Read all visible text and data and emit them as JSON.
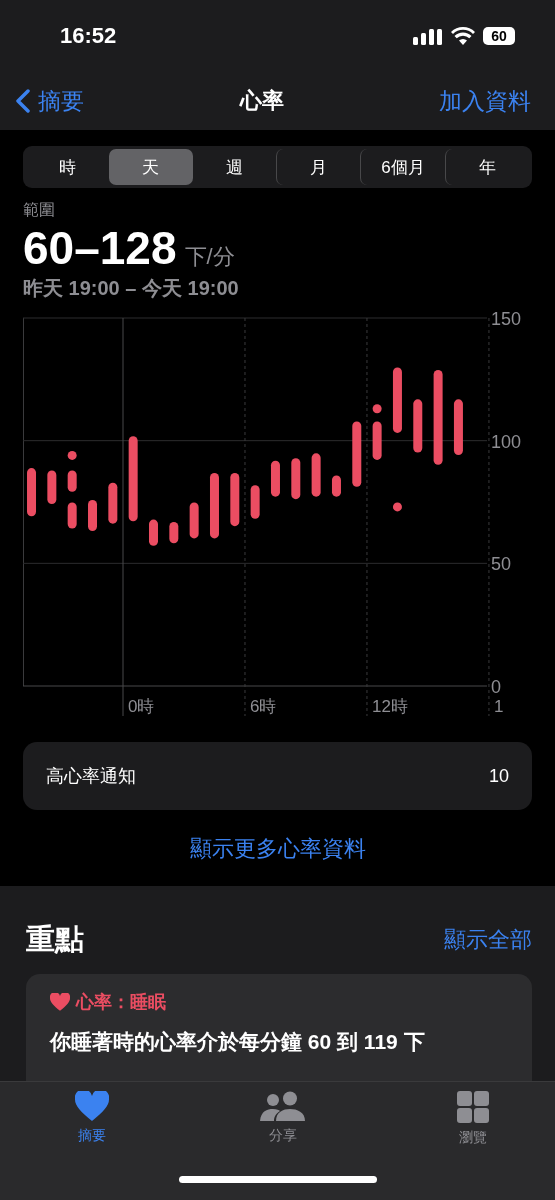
{
  "status_bar": {
    "time": "16:52",
    "battery": "60"
  },
  "nav": {
    "back": "摘要",
    "title": "心率",
    "action": "加入資料"
  },
  "segments": [
    {
      "label": "時",
      "selected": false
    },
    {
      "label": "天",
      "selected": true
    },
    {
      "label": "週",
      "selected": false
    },
    {
      "label": "月",
      "selected": false
    },
    {
      "label": "6個月",
      "selected": false
    },
    {
      "label": "年",
      "selected": false
    }
  ],
  "summary": {
    "label": "範圍",
    "value": "60–128",
    "unit": "下/分",
    "period": "昨天 19:00 – 今天 19:00"
  },
  "chart": {
    "y_labels": [
      "150",
      "100",
      "50",
      "0"
    ],
    "x_labels": [
      "0時",
      "6時",
      "12時",
      "1"
    ]
  },
  "alert_row": {
    "label": "高心率通知",
    "value": "10"
  },
  "more_link": "顯示更多心率資料",
  "highlights": {
    "title": "重點",
    "show_all": "顯示全部",
    "card": {
      "category": "心率：睡眠",
      "text": "你睡著時的心率介於每分鐘 60 到 119 下"
    }
  },
  "tab_bar": [
    {
      "label": "摘要",
      "kind": "heart",
      "selected": true
    },
    {
      "label": "分享",
      "kind": "people",
      "selected": false
    },
    {
      "label": "瀏覽",
      "kind": "grid",
      "selected": false
    }
  ]
}
